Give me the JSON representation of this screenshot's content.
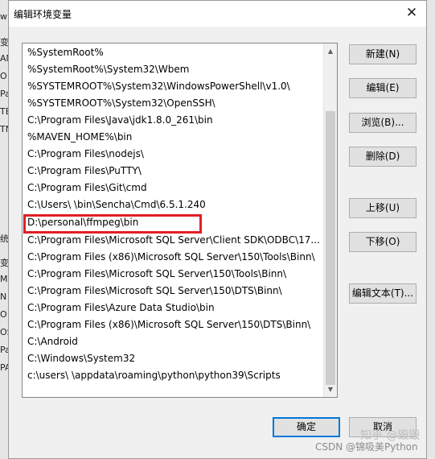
{
  "window": {
    "title": "编辑环境变量",
    "close_glyph": "✕"
  },
  "path_list": {
    "items": [
      "%SystemRoot%",
      "%SystemRoot%\\System32\\Wbem",
      "%SYSTEMROOT%\\System32\\WindowsPowerShell\\v1.0\\",
      "%SYSTEMROOT%\\System32\\OpenSSH\\",
      "C:\\Program Files\\Java\\jdk1.8.0_261\\bin",
      "%MAVEN_HOME%\\bin",
      "C:\\Program Files\\nodejs\\",
      "C:\\Program Files\\PuTTY\\",
      "C:\\Program Files\\Git\\cmd",
      "C:\\Users\\        \\bin\\Sencha\\Cmd\\6.5.1.240",
      "D:\\personal\\ffmpeg\\bin",
      "C:\\Program Files\\Microsoft SQL Server\\Client SDK\\ODBC\\17...",
      "C:\\Program Files (x86)\\Microsoft SQL Server\\150\\Tools\\Binn\\",
      "C:\\Program Files\\Microsoft SQL Server\\150\\Tools\\Binn\\",
      "C:\\Program Files\\Microsoft SQL Server\\150\\DTS\\Binn\\",
      "C:\\Program Files\\Azure Data Studio\\bin",
      "C:\\Program Files (x86)\\Microsoft SQL Server\\150\\DTS\\Binn\\",
      "C:\\Android",
      "C:\\Windows\\System32",
      "c:\\users\\        \\appdata\\roaming\\python\\python39\\Scripts"
    ],
    "highlight_color": "#e11f25"
  },
  "buttons": {
    "new": "新建(N)",
    "edit": "编辑(E)",
    "browse": "浏览(B)...",
    "delete": "删除(D)",
    "move_up": "上移(U)",
    "move_down": "下移(O)",
    "edit_text": "编辑文本(T)...",
    "ok": "确定",
    "cancel": "取消"
  },
  "scrollbar": {
    "up_glyph": "▲",
    "down_glyph": "▼"
  },
  "background_window": {
    "left_fragments": [
      "w",
      "变",
      "AN",
      "O",
      "Pa",
      "TE",
      "TN",
      "统",
      "变",
      "M",
      "N",
      "O",
      "OS",
      "Pa",
      "PA"
    ]
  },
  "watermarks": {
    "zhihu": "知乎 @毁毁",
    "csdn": "CSDN @锦吸美Python"
  },
  "colors": {
    "accent": "#0078d7",
    "highlight": "#e11f25"
  }
}
